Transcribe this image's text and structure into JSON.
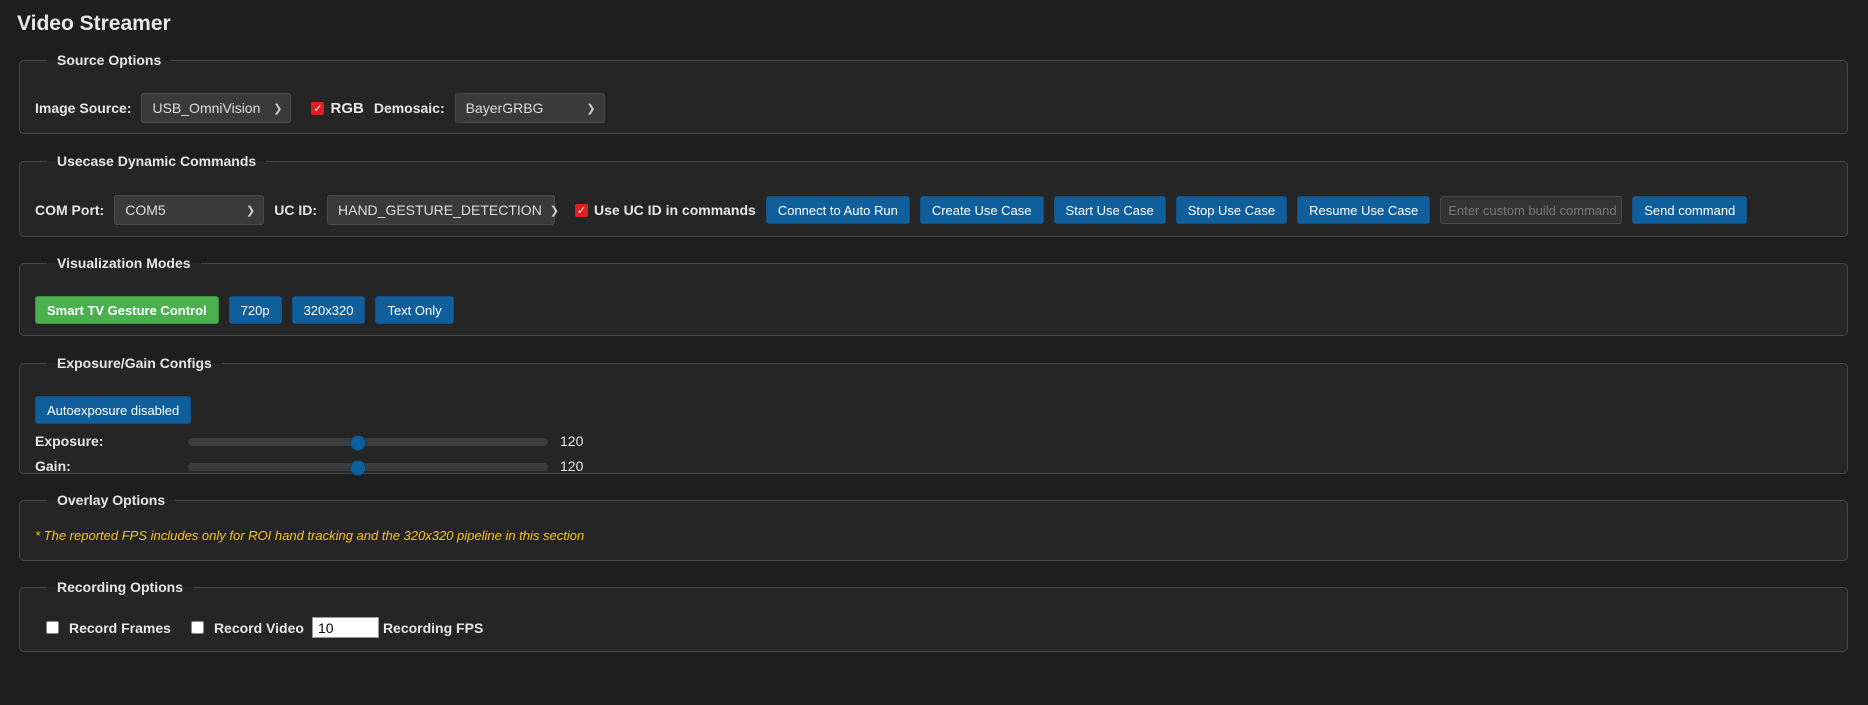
{
  "title": "Video Streamer",
  "colors": {
    "primary": "#0f5f9c",
    "active": "#4caf50",
    "note": "#f5c518",
    "checked": "#e02020"
  },
  "source": {
    "legend": "Source Options",
    "image_source_label": "Image Source:",
    "image_source_value": "USB_OmniVision",
    "rgb_label": "RGB",
    "rgb_checked": true,
    "demosaic_label": "Demosaic:",
    "demosaic_value": "BayerGRBG"
  },
  "usecase": {
    "legend": "Usecase Dynamic Commands",
    "com_port_label": "COM Port:",
    "com_port_value": "COM5",
    "uc_id_label": "UC ID:",
    "uc_id_value": "HAND_GESTURE_DETECTION",
    "use_uc_id_label": "Use UC ID in commands",
    "use_uc_id_checked": true,
    "buttons": [
      "Connect to Auto Run",
      "Create Use Case",
      "Start Use Case",
      "Stop Use Case",
      "Resume Use Case"
    ],
    "custom_command_placeholder": "Enter custom build command",
    "send_label": "Send command"
  },
  "visualization": {
    "legend": "Visualization Modes",
    "modes": [
      "Smart TV Gesture Control",
      "720p",
      "320x320",
      "Text Only"
    ],
    "active_mode": "Smart TV Gesture Control"
  },
  "exposure": {
    "legend": "Exposure/Gain Configs",
    "autoexposure_label": "Autoexposure disabled",
    "exposure_label": "Exposure:",
    "exposure_value": "120",
    "gain_label": "Gain:",
    "gain_value": "120",
    "slider_fraction": 0.47
  },
  "overlay": {
    "legend": "Overlay Options",
    "note": "* The reported FPS includes only for ROI hand tracking and the 320x320 pipeline in this section"
  },
  "recording": {
    "legend": "Recording Options",
    "record_frames_label": "Record Frames",
    "record_frames_checked": false,
    "record_video_label": "Record Video",
    "record_video_checked": false,
    "fps_value": "10",
    "fps_label": "Recording FPS"
  }
}
